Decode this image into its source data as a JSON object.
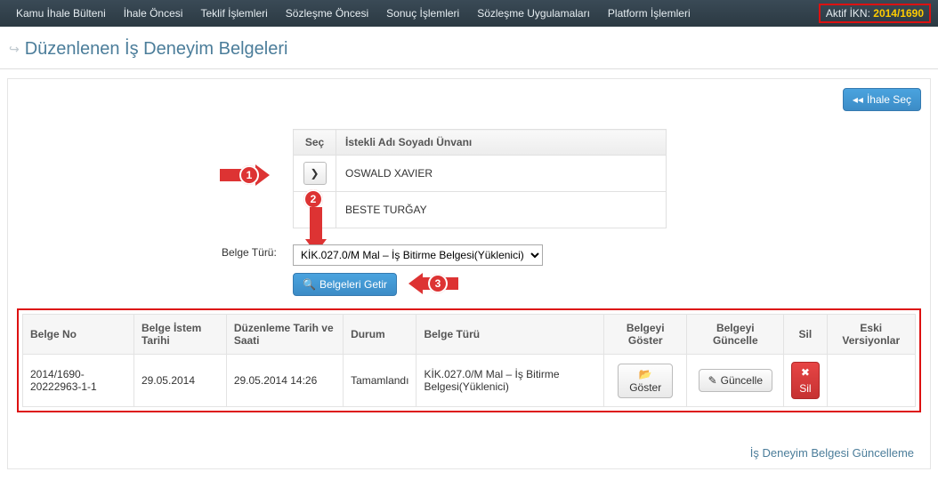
{
  "nav": {
    "items": [
      "Kamu İhale Bülteni",
      "İhale Öncesi",
      "Teklif İşlemleri",
      "Sözleşme Öncesi",
      "Sonuç İşlemleri",
      "Sözleşme Uygulamaları",
      "Platform İşlemleri"
    ],
    "ikn_label": "Aktif İKN: ",
    "ikn_value": "2014/1690"
  },
  "page": {
    "title": "Düzenlenen İş Deneyim Belgeleri"
  },
  "actions": {
    "ihale_sec": "İhale Seç",
    "belgeleri_getir": "Belgeleri Getir"
  },
  "selection_table": {
    "headers": {
      "sec": "Seç",
      "name": "İstekli Adı Soyadı Ünvanı"
    },
    "rows": [
      {
        "name": "OSWALD XAVIER"
      },
      {
        "name": "BESTE TURĞAY"
      }
    ]
  },
  "form": {
    "doc_type_label": "Belge Türü:",
    "doc_type_value": "KİK.027.0/M Mal – İş Bitirme Belgesi(Yüklenici)"
  },
  "annotations": {
    "a1": "1",
    "a2": "2",
    "a3": "3"
  },
  "results": {
    "headers": {
      "belge_no": "Belge No",
      "istem_tarihi": "Belge İstem Tarihi",
      "duzen_tarih": "Düzenleme Tarih ve Saati",
      "durum": "Durum",
      "belge_turu": "Belge Türü",
      "goster": "Belgeyi Göster",
      "guncelle": "Belgeyi Güncelle",
      "sil": "Sil",
      "eski": "Eski Versiyonlar"
    },
    "rows": [
      {
        "belge_no": "2014/1690-20222963-1-1",
        "istem_tarihi": "29.05.2014",
        "duzen_tarih": "29.05.2014 14:26",
        "durum": "Tamamlandı",
        "belge_turu": "KİK.027.0/M Mal – İş Bitirme Belgesi(Yüklenici)",
        "goster_label": "Göster",
        "guncelle_label": "Güncelle",
        "sil_label": "Sil"
      }
    ]
  },
  "footer": {
    "link": "İş Deneyim Belgesi Güncelleme"
  }
}
